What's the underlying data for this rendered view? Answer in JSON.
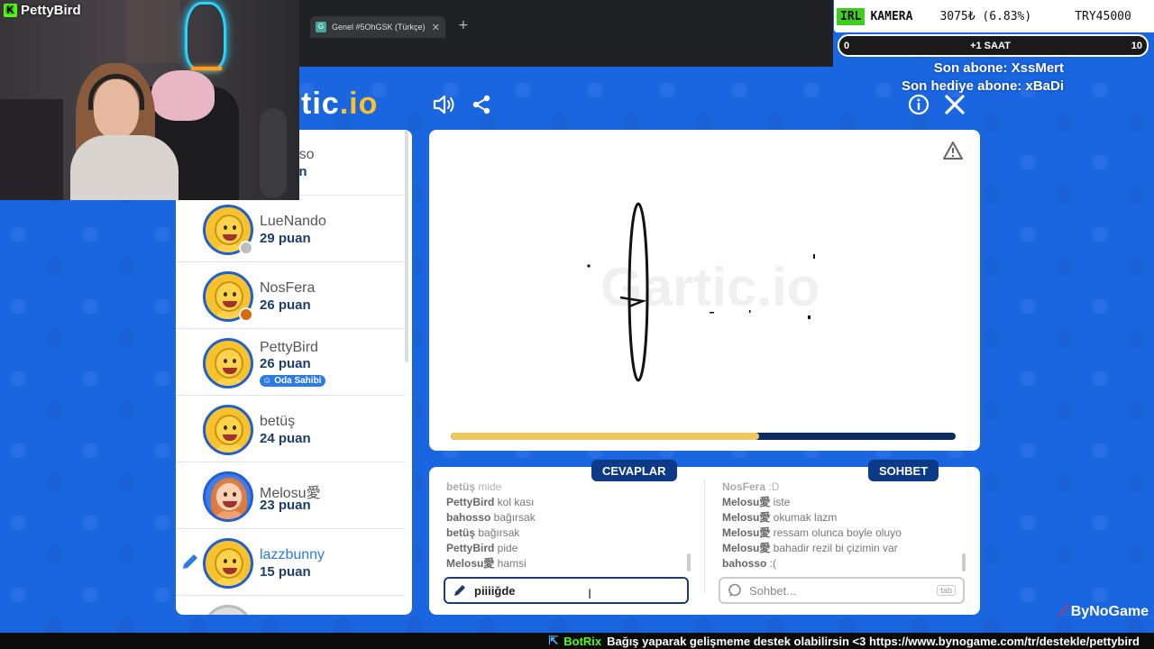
{
  "browser": {
    "tab_title": "Genel #5OhGSK (Türkçe) - Gartic",
    "tab_favicon": "G"
  },
  "webcam": {
    "channel_name": "PettyBird",
    "platform_icon": "K"
  },
  "overlay": {
    "irl_badge": "IRL",
    "kamera_label": "KAMERA",
    "amount_pct": "3075₺ (6.83%)",
    "goal": "TRY45000",
    "progress_min": "0",
    "progress_label": "+1 SAAT",
    "progress_max": "10",
    "last_sub": "Son abone: XssMert",
    "last_gift_sub": "Son hediye abone: xBaDi"
  },
  "header": {
    "logo_part1": "tic",
    "logo_part2": ".io"
  },
  "players": [
    {
      "name": "bahosso",
      "score": "... puan",
      "partial": true
    },
    {
      "name": "LueNando",
      "score": "29 puan",
      "status_color": "#bdbdbd"
    },
    {
      "name": "NosFera",
      "score": "26 puan",
      "status_color": "#d96a10"
    },
    {
      "name": "PettyBird",
      "score": "26 puan",
      "badge": "Oda Sahibi"
    },
    {
      "name": "betüş",
      "score": "24 puan"
    },
    {
      "name": "Melosu愛",
      "score": "23 puan",
      "avatar": "girl"
    },
    {
      "name": "lazzbunny",
      "score": "15 puan",
      "drawing": true
    }
  ],
  "canvas": {
    "watermark": "Gartic.io",
    "timer_remaining": 0.61
  },
  "answers": {
    "tab_label": "CEVAPLAR",
    "messages": [
      {
        "user": "betüş",
        "text": "mide"
      },
      {
        "user": "PettyBird",
        "text": "kol kası"
      },
      {
        "user": "bahosso",
        "text": "bağırsak"
      },
      {
        "user": "betüş",
        "text": "bağırsak"
      },
      {
        "user": "PettyBird",
        "text": "pide"
      },
      {
        "user": "Melosu愛",
        "text": "hamsi"
      }
    ],
    "input_value": "piiiiğde"
  },
  "chat": {
    "tab_label": "SOHBET",
    "messages": [
      {
        "user": "NosFera",
        "text": ":D"
      },
      {
        "user": "Melosu愛",
        "text": "iste"
      },
      {
        "user": "Melosu愛",
        "text": "okumak lazm"
      },
      {
        "user": "Melosu愛",
        "text": "ressam olunca boyle oluyo"
      },
      {
        "user": "Melosu愛",
        "text": "bahadir rezil bi çizimin var"
      },
      {
        "user": "bahosso",
        "text": ":("
      }
    ],
    "input_placeholder": "Sohbet...",
    "tab_hint": "tab"
  },
  "footer": {
    "bot_name": "BotRix",
    "ticker": "Bağış yaparak gelişmeme destek olabilirsin <3 https://www.bynogame.com/tr/destekle/pettybird",
    "brand": "ByNoGame"
  },
  "colors": {
    "background": "#1a66e0",
    "accent_navy": "#0d3a86",
    "timer_fill": "#eec862",
    "kick_green": "#53fc18"
  }
}
